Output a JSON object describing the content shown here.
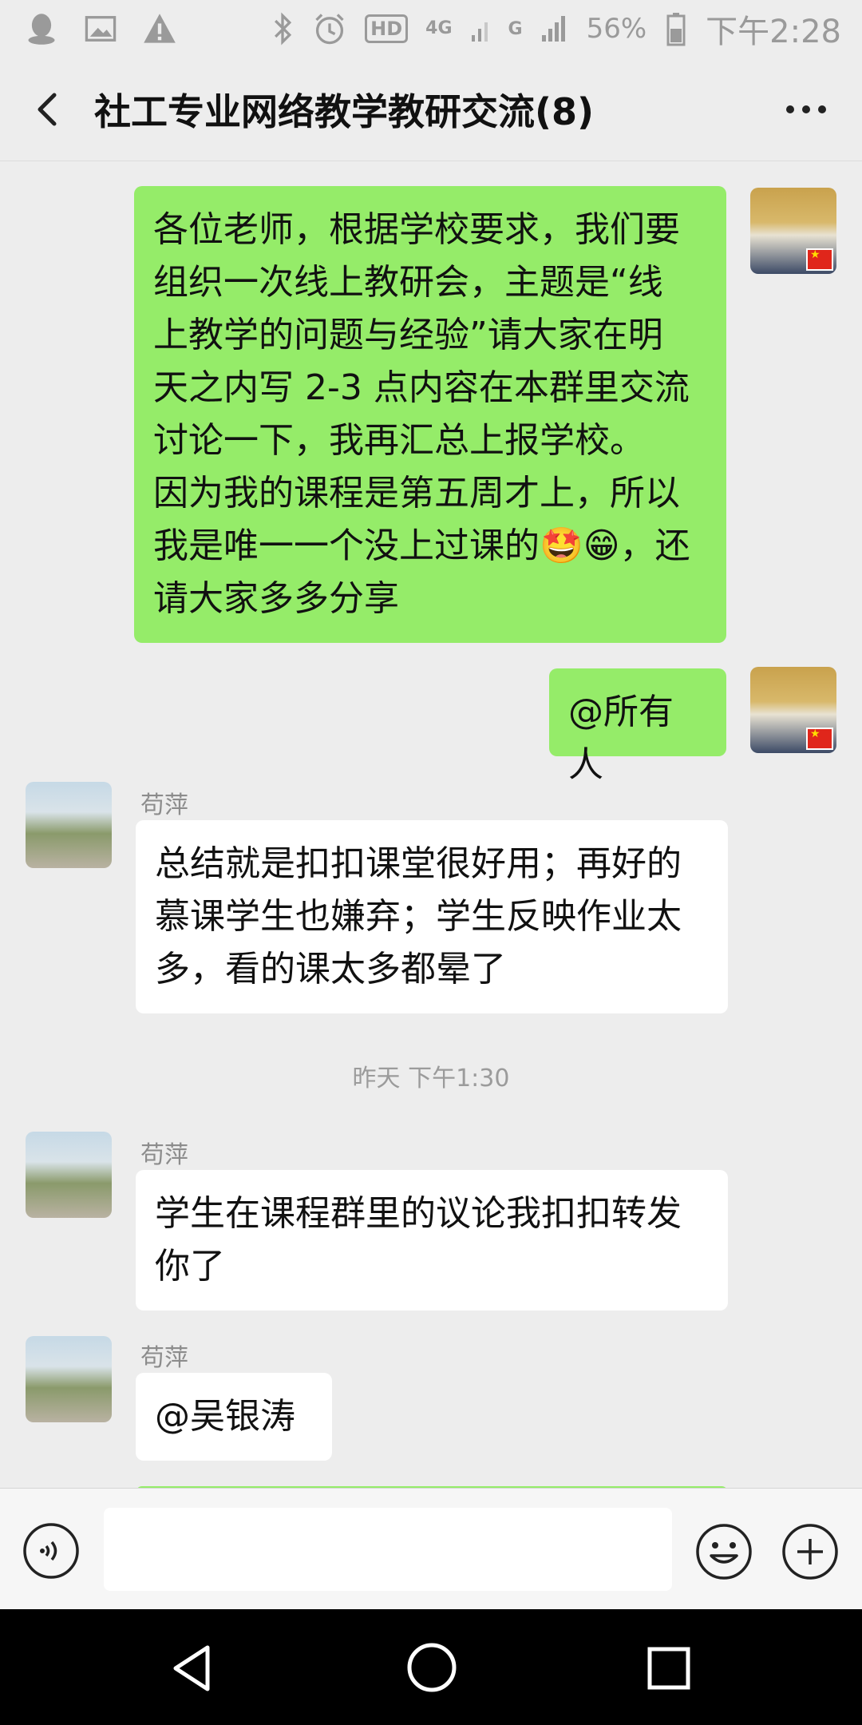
{
  "status_bar": {
    "battery": "56%",
    "time": "下午2:28",
    "hd_label": "HD",
    "net_4g": "4G",
    "net_g": "G",
    "icons": [
      "qq-icon",
      "gallery-icon",
      "warning-icon",
      "bluetooth-icon",
      "alarm-icon",
      "signal-icon",
      "battery-icon"
    ]
  },
  "header": {
    "title": "社工专业网络教学教研交流(8)",
    "back_icon": "chevron-left-icon",
    "more_icon": "more-dots-icon"
  },
  "messages": [
    {
      "sender": "me",
      "text": "各位老师，根据学校要求，我们要\n组织一次线上教研会，主题是“线\n上教学的问题与经验”请大家在明\n天之内写 2-3 点内容在本群里交流\n讨论一下，我再汇总上报学校。\n因为我的课程是第五周才上，所以\n我是唯一一个没上过课的🤩😁，还\n请大家多多分享"
    },
    {
      "sender": "me",
      "text": "@所有人"
    },
    {
      "sender": "苟萍",
      "text": "总结就是扣扣课堂很好用；再好的\n慕课学生也嫌弃；学生反映作业太\n多，看的课太多都晕了"
    },
    {
      "timestamp": "昨天 下午1:30"
    },
    {
      "sender": "苟萍",
      "text": "学生在课程群里的议论我扣扣转发\n你了"
    },
    {
      "sender": "苟萍",
      "text": "@吴银涛"
    }
  ],
  "input_bar": {
    "voice_icon": "voice-icon",
    "emoji_icon": "emoji-icon",
    "plus_icon": "plus-icon",
    "text": ""
  },
  "nav_bar": {
    "icons": [
      "nav-back-icon",
      "nav-home-icon",
      "nav-recents-icon"
    ]
  },
  "colors": {
    "bubble_me": "#95ec69",
    "bubble_other": "#ffffff",
    "chat_bg": "#ededed"
  }
}
